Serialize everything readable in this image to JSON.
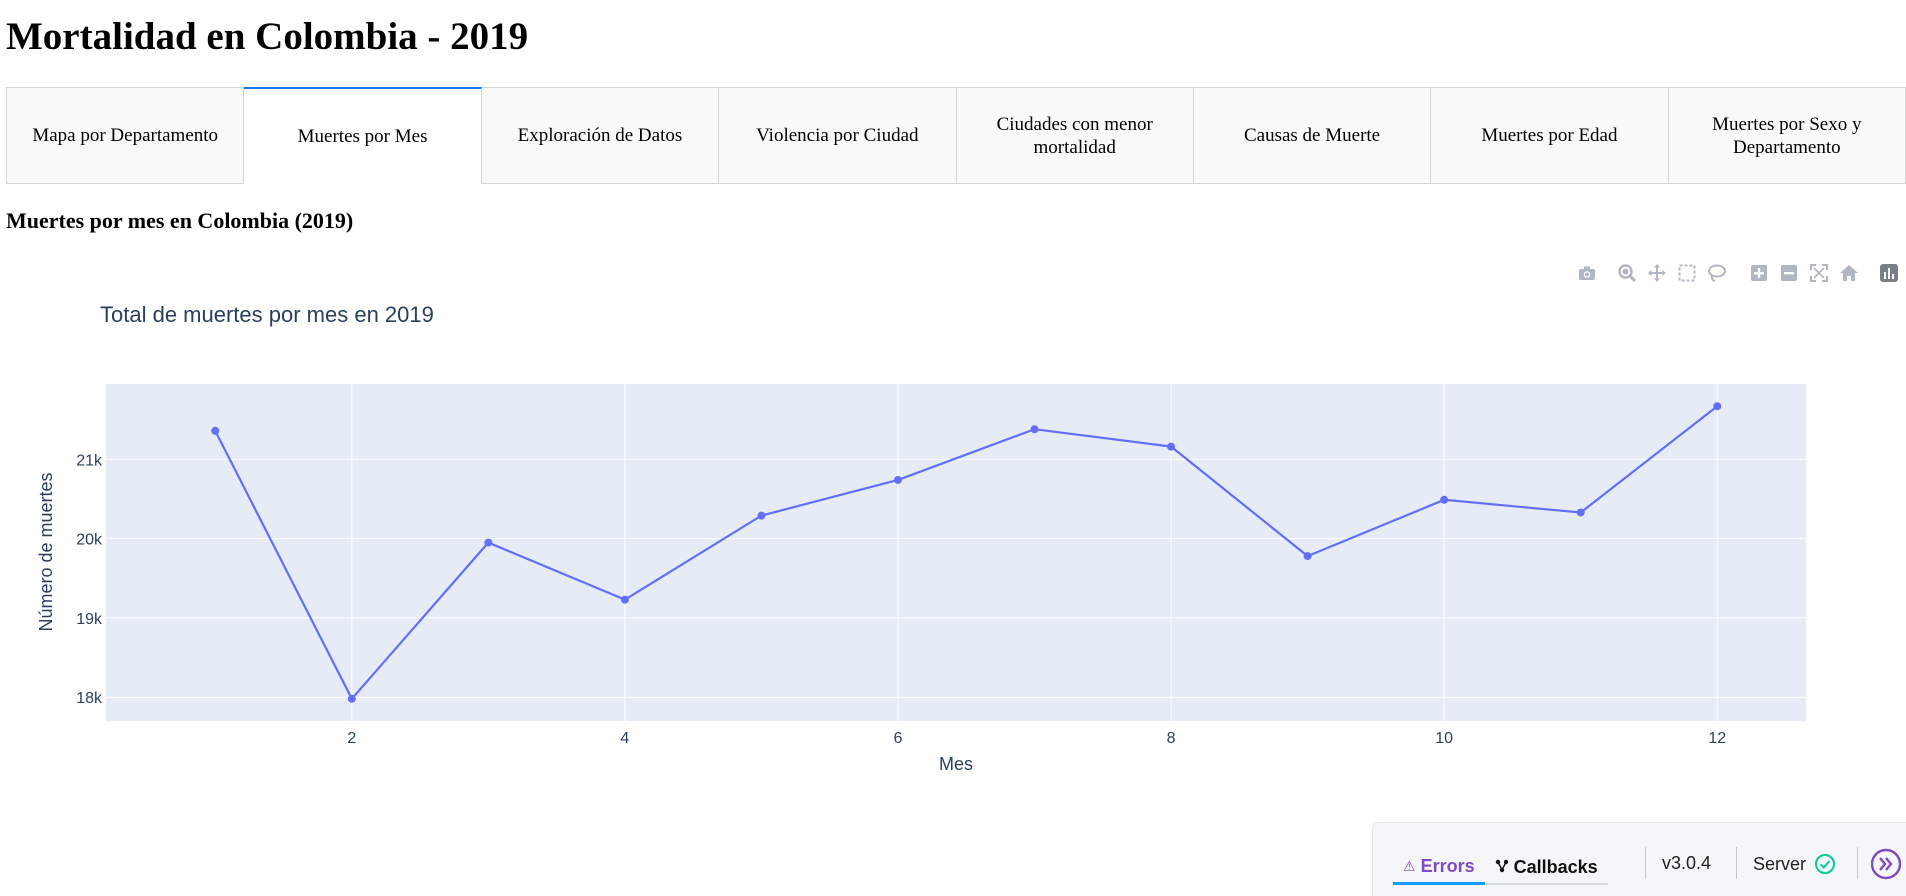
{
  "page": {
    "title": "Mortalidad en Colombia - 2019",
    "section_title": "Muertes por mes en Colombia (2019)"
  },
  "tabs": [
    {
      "label": "Mapa por Departamento",
      "active": false
    },
    {
      "label": "Muertes por Mes",
      "active": true
    },
    {
      "label": "Exploración de Datos",
      "active": false
    },
    {
      "label": "Violencia por Ciudad",
      "active": false
    },
    {
      "label": "Ciudades con menor mortalidad",
      "active": false
    },
    {
      "label": "Causas de Muerte",
      "active": false
    },
    {
      "label": "Muertes por Edad",
      "active": false
    },
    {
      "label": "Muertes por Sexo y Departamento",
      "active": false
    }
  ],
  "modebar": {
    "icons": [
      "camera-icon",
      "zoom-icon",
      "pan-icon",
      "box-select-icon",
      "lasso-icon",
      "zoom-in-icon",
      "zoom-out-icon",
      "autoscale-icon",
      "reset-axes-icon",
      "plotly-logo-icon"
    ],
    "color": "#b0b7c2"
  },
  "chart_data": {
    "type": "line",
    "title": "Total de muertes por mes en 2019",
    "xlabel": "Mes",
    "ylabel": "Número de muertes",
    "x": [
      1,
      2,
      3,
      4,
      5,
      6,
      7,
      8,
      9,
      10,
      11,
      12
    ],
    "series": [
      {
        "values": [
          21360,
          17980,
          19950,
          19230,
          20290,
          20740,
          21380,
          21160,
          19780,
          20490,
          20330,
          21670
        ]
      }
    ],
    "xlim": [
      0.2,
      12.65
    ],
    "ylim": [
      17700,
      21950
    ],
    "xticks": [
      2,
      4,
      6,
      8,
      10,
      12
    ],
    "xtick_labels": [
      "2",
      "4",
      "6",
      "8",
      "10",
      "12"
    ],
    "yticks": [
      18000,
      19000,
      20000,
      21000
    ],
    "ytick_labels": [
      "18k",
      "19k",
      "20k",
      "21k"
    ],
    "grid": true,
    "legend": "none",
    "colors": {
      "line": "#636efa",
      "plot_bg": "#e5ecf6",
      "grid": "#ffffff",
      "text": "#2a3f5f"
    }
  },
  "debug_menu": {
    "errors_label": "Errors",
    "callbacks_label": "Callbacks",
    "version": "v3.0.4",
    "server_label": "Server",
    "accent": "#7f4bc4",
    "ok_color": "#00cc96"
  }
}
